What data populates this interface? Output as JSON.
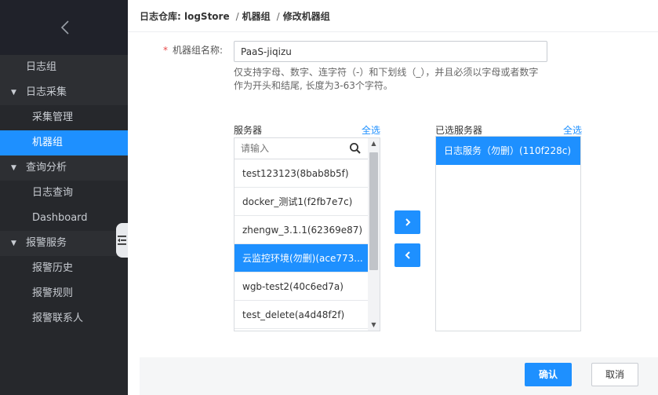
{
  "sidebar": {
    "back_icon": "chevron-left-icon",
    "items": [
      {
        "label": "日志组"
      },
      {
        "label": "日志采集"
      },
      {
        "label": "采集管理"
      },
      {
        "label": "机器组"
      },
      {
        "label": "查询分析"
      },
      {
        "label": "日志查询"
      },
      {
        "label": "Dashboard"
      },
      {
        "label": "报警服务"
      },
      {
        "label": "报警历史"
      },
      {
        "label": "报警规则"
      },
      {
        "label": "报警联系人"
      }
    ],
    "caret": "▼",
    "toggle_icon": "collapse-menu-icon"
  },
  "breadcrumb": {
    "root": "日志仓库: logStore",
    "sep": "/",
    "level2": "机器组",
    "level3": "修改机器组"
  },
  "form": {
    "required_mark": "*",
    "name_label": "机器组名称:",
    "name_value": "PaaS-jiqizu",
    "hint_line1": "仅支持字母、数字、连字符（-）和下划线（_），并且必须以字母或者数字",
    "hint_line2": "作为开头和结尾, 长度为3-63个字符。"
  },
  "servers": {
    "title": "服务器",
    "select_all": "全选",
    "search_placeholder": "请输入",
    "items": [
      {
        "label": "test123123(8bab8b5f)"
      },
      {
        "label": "docker_测试1(f2fb7e7c)"
      },
      {
        "label": "zhengw_3.1.1(62369e87)"
      },
      {
        "label": "云监控环境(勿删)(ace773..."
      },
      {
        "label": "wgb-test2(40c6ed7a)"
      },
      {
        "label": "test_delete(a4d48f2f)"
      }
    ],
    "selected_index": 3
  },
  "selected_servers": {
    "title": "已选服务器",
    "select_all": "全选",
    "items": [
      {
        "label": "日志服务（勿删）(110f228c)"
      }
    ]
  },
  "transfer": {
    "right_label": "›",
    "left_label": "‹"
  },
  "footer": {
    "confirm_label": "确认",
    "cancel_label": "取消"
  }
}
